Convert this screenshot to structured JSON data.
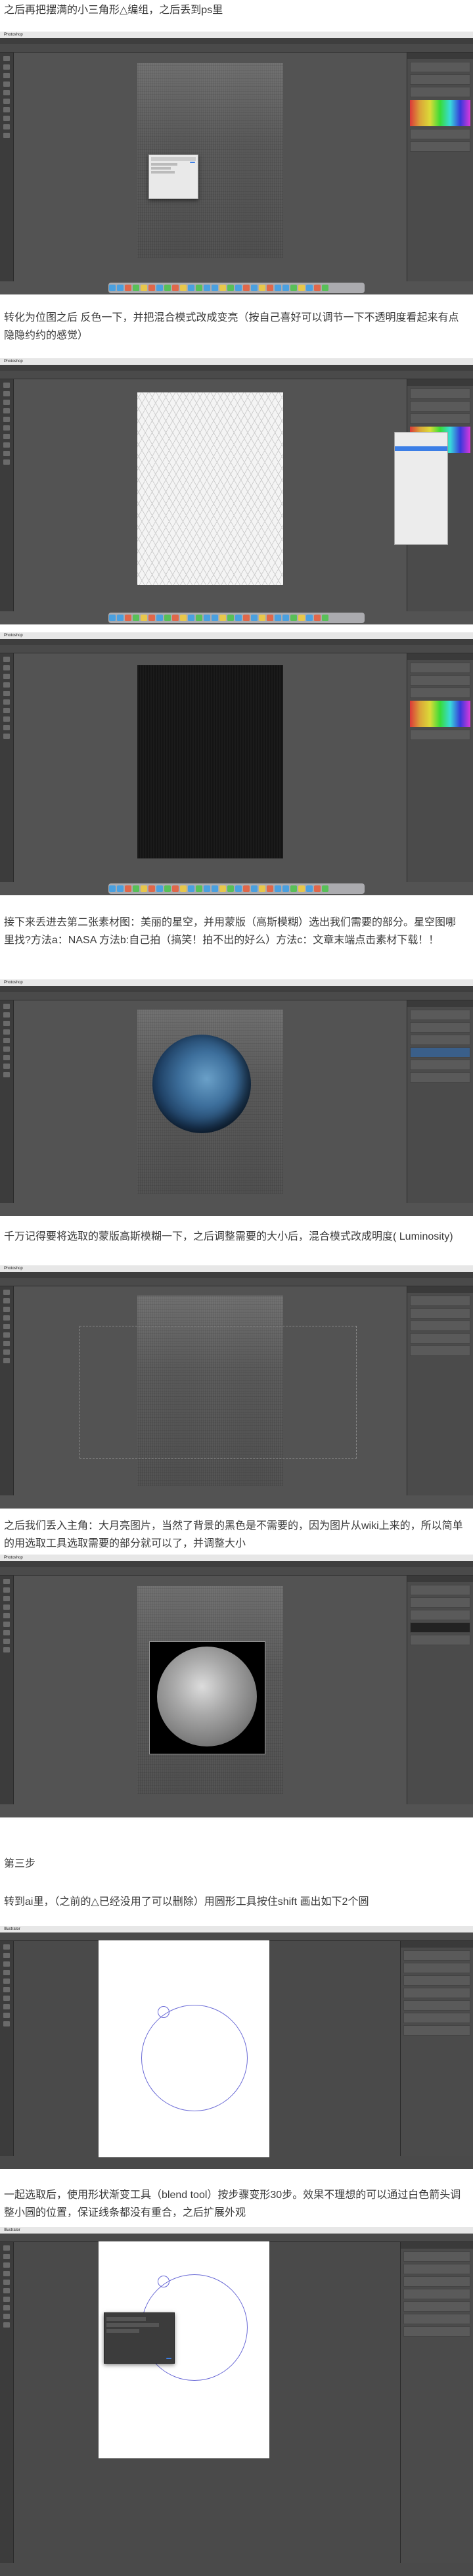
{
  "paragraphs": {
    "p1": "之后再把摆满的小三角形△编组，之后丢到ps里",
    "p2": "转化为位图之后 反色一下，并把混合模式改成变亮（按自己喜好可以调节一下不透明度看起来有点隐隐约约的感觉）",
    "p3": "接下来丢进去第二张素材图：美丽的星空，并用蒙版（高斯模糊）选出我们需要的部分。星空图哪里找?方法a：NASA 方法b:自己拍（搞笑！拍不出的好么）方法c：文章末端点击素材下载！！",
    "p4": "千万记得要将选取的蒙版高斯模糊一下，之后调整需要的大小后，混合模式改成明度( Luminosity)",
    "p5": "之后我们丢入主角：大月亮图片，当然了背景的黑色是不需要的，因为图片从wiki上来的，所以简单的用选取工具选取需要的部分就可以了，并调整大小",
    "p6": "第三步",
    "p7": "转到ai里，（之前的△已经没用了可以删除）用圆形工具按住shift 画出如下2个圆",
    "p8": "一起选取后，使用形状渐变工具（blend tool）按步骤变形30步。效果不理想的可以通过白色箭头调整小圆的位置，保证线条都没有重合，之后扩展外观"
  },
  "screens": {
    "app_name": "Photoshop",
    "ai_app_name": "Illustrator"
  }
}
